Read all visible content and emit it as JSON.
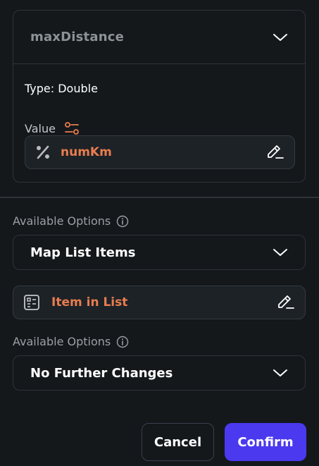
{
  "param_card": {
    "title": "maxDistance",
    "type_line": "Type: Double",
    "value_label": "Value",
    "value_text": "numKm"
  },
  "options_1": {
    "label": "Available Options",
    "selected": "Map List Items",
    "item_text": "Item in List"
  },
  "options_2": {
    "label": "Available Options",
    "selected": "No Further Changes"
  },
  "footer": {
    "cancel_label": "Cancel",
    "confirm_label": "Confirm"
  },
  "colors": {
    "background": "#14181b",
    "accent_orange": "#e97d4f",
    "primary": "#4b39ef"
  },
  "icons": [
    "chevron-down-icon",
    "sliders-icon",
    "percent-icon",
    "edit-pencil-icon",
    "info-icon",
    "list-item-icon"
  ]
}
